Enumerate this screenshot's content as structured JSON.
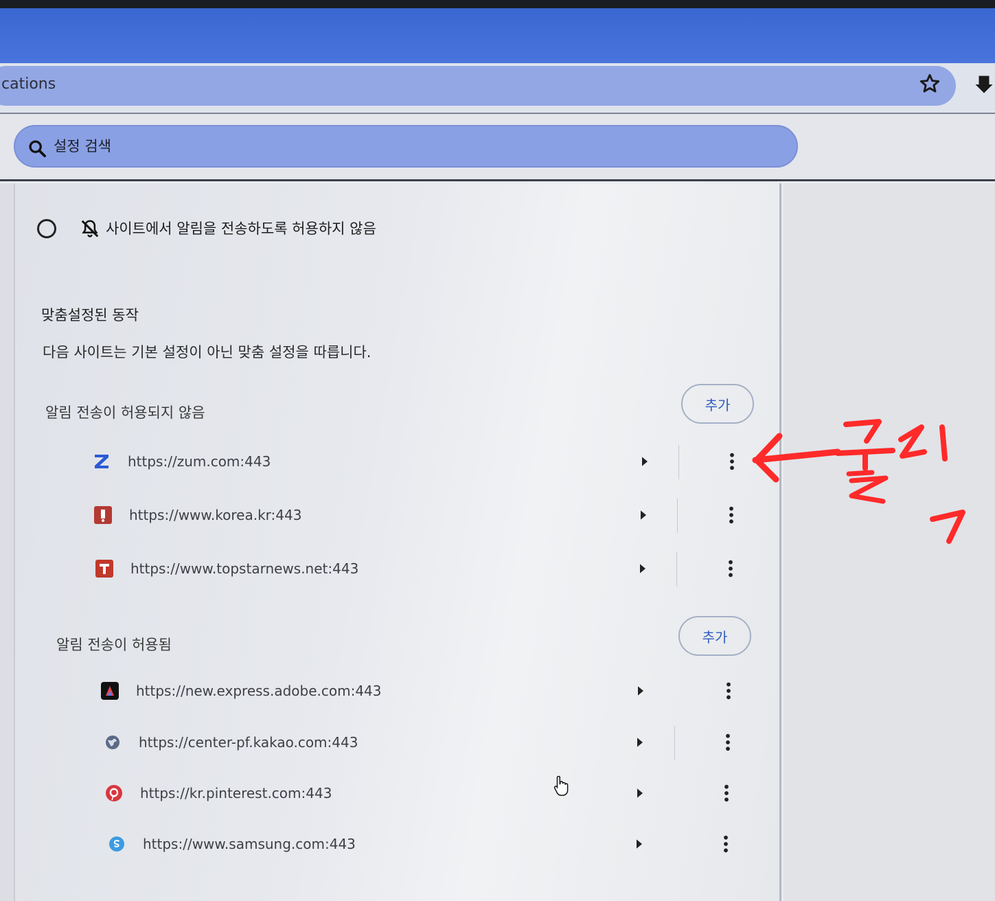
{
  "browser": {
    "address_text": "cations"
  },
  "settings_search": {
    "placeholder": "설정 검색"
  },
  "default_behavior": {
    "block_option_label": "사이트에서 알림을 전송하도록 허용하지 않음"
  },
  "custom_behavior": {
    "title": "맞춤설정된 동작",
    "description": "다음 사이트는 기본 설정이 아닌 맞춤 설정을 따릅니다.",
    "blocked": {
      "header": "알림 전송이 허용되지 않음",
      "add_label": "추가",
      "sites": [
        {
          "url": "https://zum.com:443",
          "icon": "zum-z-icon"
        },
        {
          "url": "https://www.korea.kr:443",
          "icon": "korea-kr-icon"
        },
        {
          "url": "https://www.topstarnews.net:443",
          "icon": "topstarnews-t-icon"
        }
      ]
    },
    "allowed": {
      "header": "알림 전송이 허용됨",
      "add_label": "추가",
      "sites": [
        {
          "url": "https://new.express.adobe.com:443",
          "icon": "adobe-express-icon"
        },
        {
          "url": "https://center-pf.kakao.com:443",
          "icon": "globe-icon"
        },
        {
          "url": "https://kr.pinterest.com:443",
          "icon": "pinterest-icon"
        },
        {
          "url": "https://www.samsung.com:443",
          "icon": "samsung-s-icon"
        }
      ]
    }
  },
  "colors": {
    "accent": "#2e5bbf",
    "title_bar": "#4a74dc",
    "annotation": "#ff2a2a"
  }
}
